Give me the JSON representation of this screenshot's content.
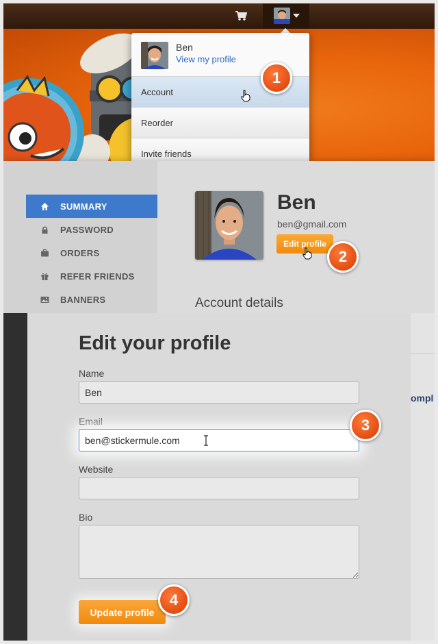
{
  "colors": {
    "accent_orange": "#f18a0a",
    "active_blue": "#3d7acb",
    "link_blue": "#2a6ac7",
    "badge_orange": "#e34d12"
  },
  "topbar": {
    "cart_icon": "shopping-cart-icon",
    "avatar_caret_icon": "caret-down-icon"
  },
  "dropdown": {
    "user_name": "Ben",
    "view_profile_link": "View my profile",
    "items": [
      {
        "label": "Account",
        "active": true
      },
      {
        "label": "Reorder",
        "active": false
      },
      {
        "label": "Invite friends",
        "active": false
      }
    ]
  },
  "sidebar": {
    "items": [
      {
        "label": "SUMMARY",
        "icon": "home-icon",
        "active": true
      },
      {
        "label": "PASSWORD",
        "icon": "lock-icon",
        "active": false
      },
      {
        "label": "ORDERS",
        "icon": "briefcase-icon",
        "active": false
      },
      {
        "label": "REFER FRIENDS",
        "icon": "gift-icon",
        "active": false
      },
      {
        "label": "BANNERS",
        "icon": "image-icon",
        "active": false
      }
    ]
  },
  "summary": {
    "name": "Ben",
    "email": "ben@gmail.com",
    "edit_button": "Edit profile",
    "section_title": "Account details"
  },
  "edit_form": {
    "title": "Edit your profile",
    "name_label": "Name",
    "name_value": "Ben",
    "email_label": "Email",
    "email_value": "ben@stickermule.com",
    "website_label": "Website",
    "website_value": "",
    "bio_label": "Bio",
    "bio_value": "",
    "submit_button": "Update profile",
    "side_peek_text": "ompl"
  },
  "callouts": [
    "1",
    "2",
    "3",
    "4"
  ]
}
